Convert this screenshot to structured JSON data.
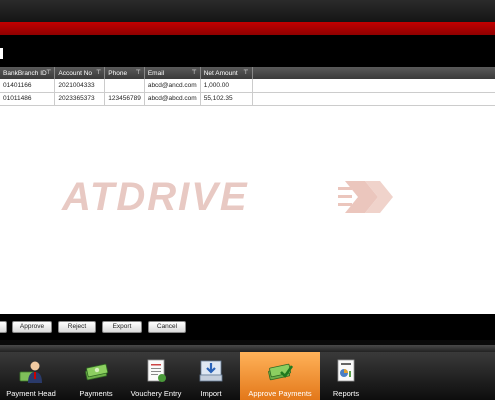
{
  "table": {
    "columns": [
      "BankBranch ID",
      "Account No",
      "Phone",
      "Email",
      "Net Amount"
    ],
    "rows": [
      [
        "01401166",
        "2021004333",
        "",
        "abcd@ancd.com",
        "1,000.00"
      ],
      [
        "01011486",
        "2023365373",
        "123456789",
        "abcd@abcd.com",
        "55,102.35"
      ]
    ]
  },
  "watermark": "ATDRIVE",
  "buttons": {
    "approve": "Approve",
    "reject": "Reject",
    "export": "Export",
    "cancel": "Cancel"
  },
  "nav": [
    {
      "label": "Payment Head",
      "icon": "person-icon"
    },
    {
      "label": "Payments",
      "icon": "money-icon"
    },
    {
      "label": "Vouchery Entry",
      "icon": "voucher-document-icon"
    },
    {
      "label": "Import",
      "icon": "import-icon"
    },
    {
      "label": "Approve Payments",
      "icon": "approve-money-icon",
      "active": true
    },
    {
      "label": "Reports",
      "icon": "reports-icon"
    }
  ],
  "colors": {
    "accent_red": "#c30000",
    "active_tab": "#f28c28",
    "watermark": "#e8c9c3"
  }
}
